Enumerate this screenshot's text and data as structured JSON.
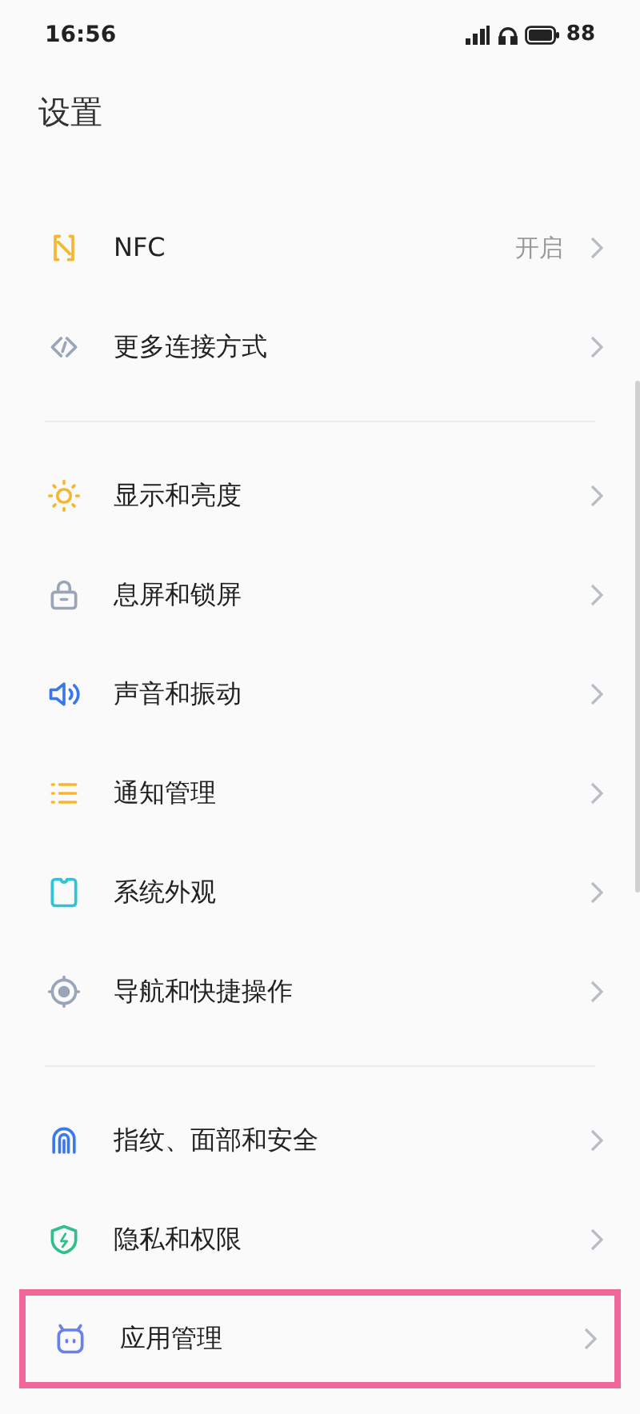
{
  "status_bar": {
    "time": "16:56",
    "battery": "88"
  },
  "title": "设置",
  "groups": [
    {
      "items": [
        {
          "kind": "nfc",
          "label": "NFC",
          "value": "开启",
          "highlighted": false
        },
        {
          "kind": "link",
          "label": "更多连接方式",
          "highlighted": false
        }
      ]
    },
    {
      "items": [
        {
          "kind": "sun",
          "label": "显示和亮度",
          "highlighted": false
        },
        {
          "kind": "lock",
          "label": "息屏和锁屏",
          "highlighted": false
        },
        {
          "kind": "speaker",
          "label": "声音和振动",
          "highlighted": false
        },
        {
          "kind": "list",
          "label": "通知管理",
          "highlighted": false
        },
        {
          "kind": "theme",
          "label": "系统外观",
          "highlighted": false
        },
        {
          "kind": "target",
          "label": "导航和快捷操作",
          "highlighted": false
        }
      ]
    },
    {
      "items": [
        {
          "kind": "fingerprint",
          "label": "指纹、面部和安全",
          "highlighted": false
        },
        {
          "kind": "shield",
          "label": "隐私和权限",
          "highlighted": false
        },
        {
          "kind": "app",
          "label": "应用管理",
          "highlighted": true
        }
      ]
    }
  ]
}
